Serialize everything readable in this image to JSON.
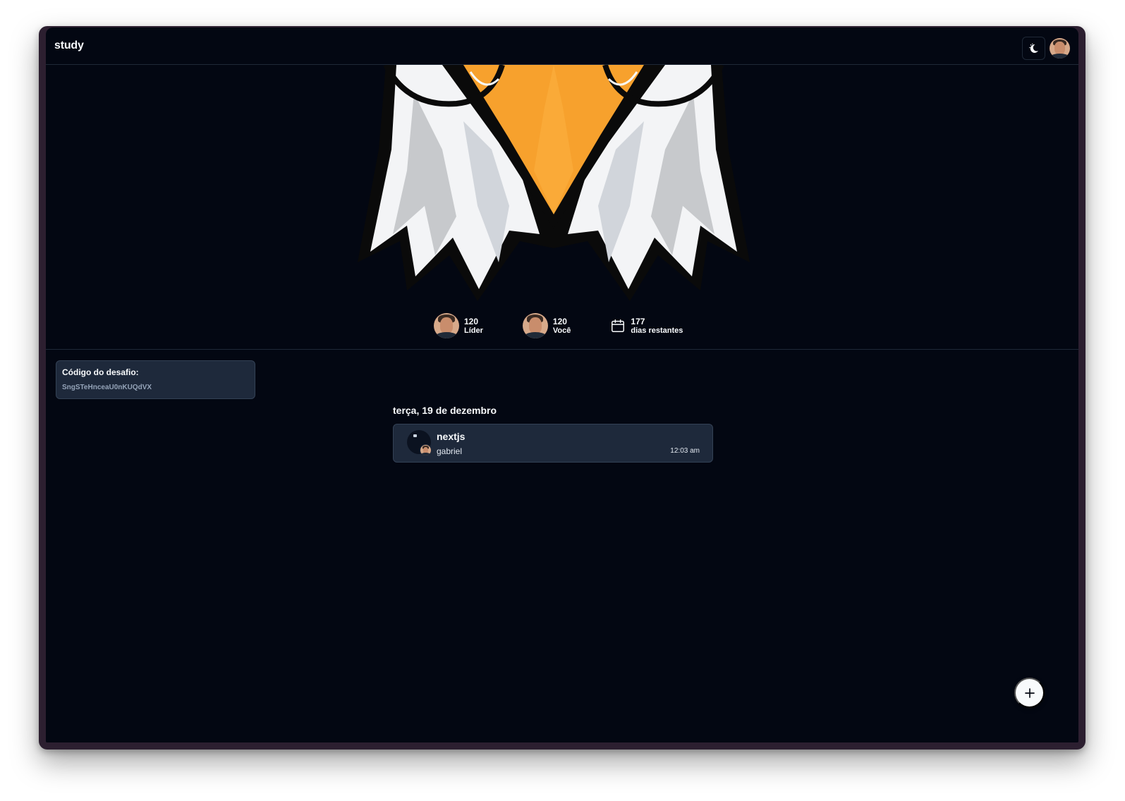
{
  "header": {
    "title": "study",
    "theme_toggle_icon": "moon-sun-icon",
    "user_avatar_icon": "user-avatar"
  },
  "stats": {
    "leader": {
      "value": "120",
      "label": "Líder"
    },
    "you": {
      "value": "120",
      "label": "Você"
    },
    "days": {
      "value": "177",
      "label": "dias restantes",
      "icon": "calendar-icon"
    }
  },
  "challenge_code": {
    "title": "Código do desafio:",
    "value": "SngSTeHnceaU0nKUQdVX"
  },
  "feed": {
    "day_label": "terça, 19 de dezembro",
    "posts": [
      {
        "title": "nextjs",
        "author": "gabriel",
        "time": "12:03 am"
      }
    ]
  },
  "fab": {
    "icon": "plus-icon"
  },
  "colors": {
    "background": "#030712",
    "card": "#1e293b",
    "border": "#1f2937",
    "text": "#f8fafc",
    "eagle_beak": "#f7a12d"
  }
}
